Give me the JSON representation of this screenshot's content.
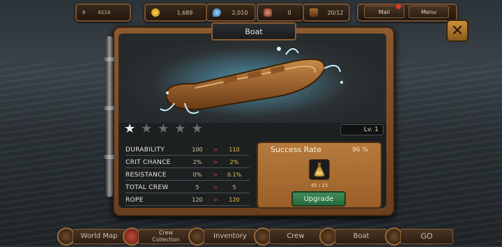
{
  "topbar": {
    "player": {
      "level": "8",
      "value": "8218"
    },
    "resources": [
      {
        "name": "gold",
        "icon": "gold-coin-icon",
        "value": "1,689"
      },
      {
        "name": "gem",
        "icon": "water-drop-icon",
        "value": "2,010"
      },
      {
        "name": "crew-power",
        "icon": "shield-icon",
        "value": "0"
      },
      {
        "name": "storage",
        "icon": "barrel-icon",
        "value": "20/12"
      }
    ],
    "mail_label": "Mail",
    "menu_label": "Menu"
  },
  "panel": {
    "title": "Boat",
    "level_label": "Lv. 1",
    "stars_total": 5,
    "stars_filled": 1,
    "stats": [
      {
        "name": "DURABILITY",
        "current": "100",
        "next": "110"
      },
      {
        "name": "CRIT CHANCE",
        "current": "2%",
        "next": "2%"
      },
      {
        "name": "RESISTANCE",
        "current": "0%",
        "next": "0.1%"
      },
      {
        "name": "TOTAL CREW",
        "current": "5",
        "next": "5"
      },
      {
        "name": "ROPE",
        "current": "120",
        "next": "120"
      }
    ],
    "arrow": ">",
    "success": {
      "title": "Success Rate",
      "rate": "96 %",
      "item_icon": "potion-flask-icon",
      "item_count": "45 / 15",
      "upgrade_label": "Upgrade"
    }
  },
  "nav": [
    {
      "key": "world-map",
      "label": "World Map"
    },
    {
      "key": "crew-collection",
      "label": "Crew Collection"
    },
    {
      "key": "inventory",
      "label": "Inventory"
    },
    {
      "key": "crew",
      "label": "Crew"
    },
    {
      "key": "boat",
      "label": "Boat"
    },
    {
      "key": "go",
      "label": "GO"
    }
  ],
  "colors": {
    "frame": "#8d5a2f",
    "accent_gold": "#e3c54e",
    "arrow_red": "#d04a36",
    "upgrade_green": "#3f8c58",
    "success_panel": "#b57a3c"
  }
}
